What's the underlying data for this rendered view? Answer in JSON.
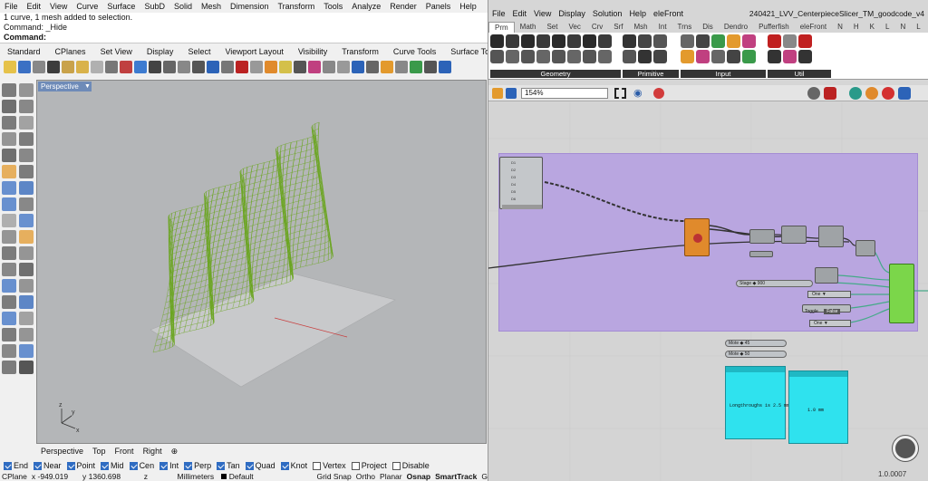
{
  "rhino": {
    "menu": [
      "File",
      "Edit",
      "View",
      "Curve",
      "Surface",
      "SubD",
      "Solid",
      "Mesh",
      "Dimension",
      "Transform",
      "Tools",
      "Analyze",
      "Render",
      "Panels",
      "Help"
    ],
    "command_history": [
      "1 curve, 1 mesh added to selection.",
      "Command: _Hide"
    ],
    "command_prompt": "Command:",
    "toolbar_tabs": [
      "Standard",
      "CPlanes",
      "Set View",
      "Display",
      "Select",
      "Viewport Layout",
      "Visibility",
      "Transform",
      "Curve Tools",
      "Surface Tools",
      "S"
    ],
    "viewport_label": "Perspective",
    "view_tabs": [
      "Perspective",
      "Top",
      "Front",
      "Right",
      "⊕"
    ],
    "osnaps": [
      {
        "label": "End",
        "checked": true
      },
      {
        "label": "Near",
        "checked": true
      },
      {
        "label": "Point",
        "checked": true
      },
      {
        "label": "Mid",
        "checked": true
      },
      {
        "label": "Cen",
        "checked": true
      },
      {
        "label": "Int",
        "checked": true
      },
      {
        "label": "Perp",
        "checked": true
      },
      {
        "label": "Tan",
        "checked": true
      },
      {
        "label": "Quad",
        "checked": true
      },
      {
        "label": "Knot",
        "checked": true
      },
      {
        "label": "Vertex",
        "checked": false
      },
      {
        "label": "Project",
        "checked": false
      },
      {
        "label": "Disable",
        "checked": false
      }
    ],
    "status": {
      "cplane": "CPlane",
      "x": "x -949.019",
      "y": "y 1360.698",
      "z": "z",
      "units": "Millimeters",
      "layer": "Default",
      "toggles": [
        "Grid Snap",
        "Ortho",
        "Planar",
        "Osnap",
        "SmartTrack",
        "G"
      ]
    }
  },
  "grasshopper": {
    "menu": [
      "File",
      "Edit",
      "View",
      "Display",
      "Solution",
      "Help",
      "eleFront"
    ],
    "document_title": "240421_LVV_CenterpieceSlicer_TM_goodcode_v4",
    "tabs": [
      "Prm",
      "Math",
      "Set",
      "Vec",
      "Crv",
      "Srf",
      "Msh",
      "Int",
      "Trns",
      "Dis",
      "Dendro",
      "Pufferfish",
      "eleFront",
      "N",
      "H",
      "K",
      "L",
      "N",
      "L",
      "C"
    ],
    "ribbon_panels": [
      "Geometry",
      "Primitive",
      "Input",
      "Util"
    ],
    "zoom": "154%",
    "version": "1.0.0007",
    "canvas": {
      "slider_labels": [
        "Stage",
        "Mote",
        "Mote"
      ],
      "slider_values": [
        "900",
        "45",
        "50"
      ],
      "dropdown_values": [
        "One",
        "One"
      ],
      "toggle_label": "Toggle",
      "toggle_value": "False",
      "panel_texts": [
        "Longthroughs is 2.5 mm",
        "1.0 mm"
      ]
    }
  },
  "colors": {
    "group": "#b9a6e0",
    "mesh": "#6aa51f",
    "selected_component": "#e08a2c",
    "panel": "#2fe2ee"
  }
}
